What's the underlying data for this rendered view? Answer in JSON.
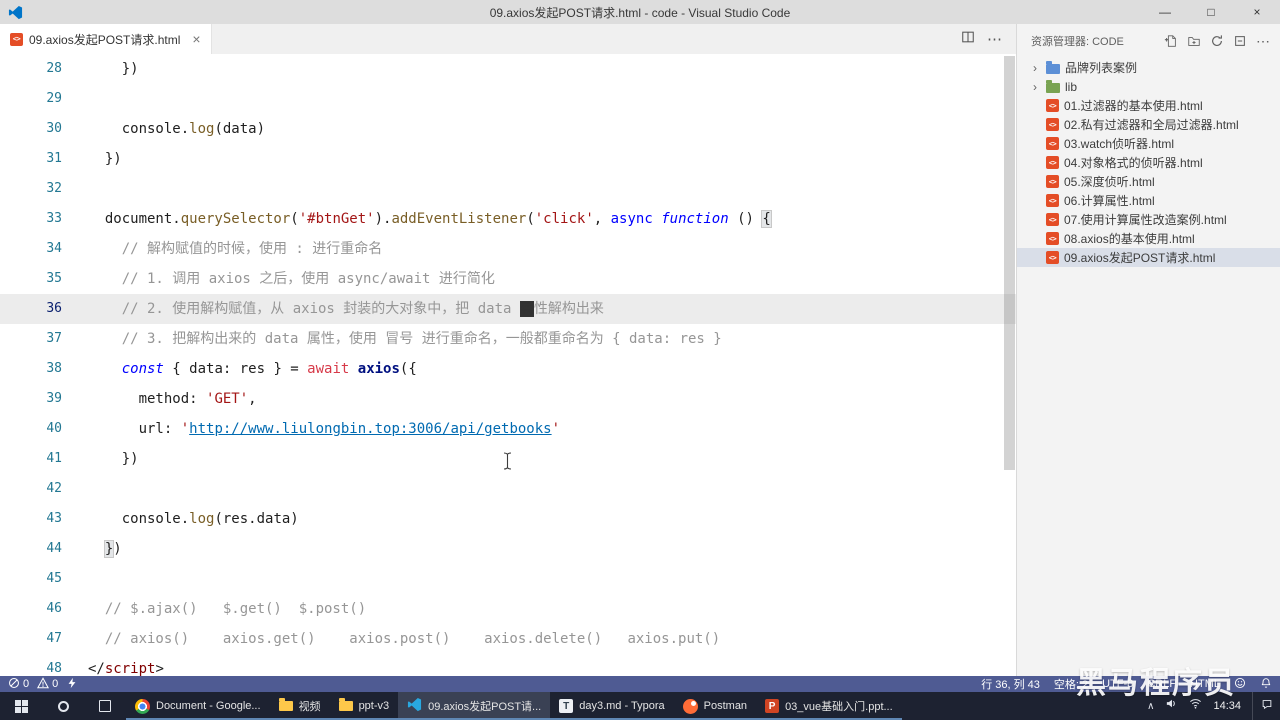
{
  "title_bar": {
    "title": "09.axios发起POST请求.html - code - Visual Studio Code",
    "minimize": "—",
    "maximize": "□",
    "close": "×"
  },
  "tab_bar": {
    "tabs": [
      {
        "label": "09.axios发起POST请求.html",
        "close": "×"
      }
    ],
    "more": "⋯"
  },
  "icons": {
    "chevron": "›",
    "chevron_up": "∧",
    "html_badge": "<>",
    "more": "⋯"
  },
  "colors": {
    "accent_blue": "#0075c9",
    "html_orange": "#e44d26",
    "status_bg": "#4f5b93"
  },
  "editor": {
    "active_line": 36,
    "lines": [
      {
        "n": 28,
        "s": [
          [
            "pl",
            "    })"
          ]
        ]
      },
      {
        "n": 29,
        "s": []
      },
      {
        "n": 30,
        "s": [
          [
            "pl",
            "    console."
          ],
          [
            "fn",
            "log"
          ],
          [
            "pl",
            "(data)"
          ]
        ]
      },
      {
        "n": 31,
        "s": [
          [
            "pl",
            "  })"
          ]
        ]
      },
      {
        "n": 32,
        "s": []
      },
      {
        "n": 33,
        "s": [
          [
            "pl",
            "  document."
          ],
          [
            "fn",
            "querySelector"
          ],
          [
            "pl",
            "("
          ],
          [
            "str",
            "'#btnGet'"
          ],
          [
            "pl",
            ")."
          ],
          [
            "fn",
            "addEventListener"
          ],
          [
            "pl",
            "("
          ],
          [
            "str",
            "'click'"
          ],
          [
            "pl",
            ", "
          ],
          [
            "kw",
            "async"
          ],
          [
            "pl",
            " "
          ],
          [
            "kwi",
            "function"
          ],
          [
            "pl",
            " () "
          ],
          [
            "bm",
            "{"
          ]
        ]
      },
      {
        "n": 34,
        "s": [
          [
            "cm",
            "    // 解构赋值的时候，使用 : 进行重命名"
          ]
        ]
      },
      {
        "n": 35,
        "s": [
          [
            "cm",
            "    // 1. 调用 axios 之后，使用 async/await 进行简化"
          ]
        ]
      },
      {
        "n": 36,
        "s": [
          [
            "cm",
            "    // 2. 使用解构赋值，从 axios 封装的大对象中，把 data "
          ],
          [
            "cur",
            "属"
          ],
          [
            "cm",
            "性解构出来"
          ]
        ]
      },
      {
        "n": 37,
        "s": [
          [
            "cm",
            "    // 3. 把解构出来的 data 属性，使用 冒号 进行重命名，一般都重命名为 { data: res }"
          ]
        ]
      },
      {
        "n": 38,
        "s": [
          [
            "pl",
            "    "
          ],
          [
            "kwi",
            "const"
          ],
          [
            "pl",
            " { data: res } = "
          ],
          [
            "aw",
            "await"
          ],
          [
            "pl",
            " "
          ],
          [
            "ax",
            "axios"
          ],
          [
            "pl",
            "({"
          ]
        ]
      },
      {
        "n": 39,
        "s": [
          [
            "pl",
            "      method: "
          ],
          [
            "str",
            "'GET'"
          ],
          [
            "pl",
            ","
          ]
        ]
      },
      {
        "n": 40,
        "s": [
          [
            "pl",
            "      url: "
          ],
          [
            "str",
            "'"
          ],
          [
            "lnk",
            "http://www.liulongbin.top:3006/api/getbooks"
          ],
          [
            "str",
            "'"
          ]
        ]
      },
      {
        "n": 41,
        "s": [
          [
            "pl",
            "    })"
          ]
        ]
      },
      {
        "n": 42,
        "s": []
      },
      {
        "n": 43,
        "s": [
          [
            "pl",
            "    console."
          ],
          [
            "fn",
            "log"
          ],
          [
            "pl",
            "(res.data)"
          ]
        ]
      },
      {
        "n": 44,
        "s": [
          [
            "pl",
            "  "
          ],
          [
            "bm",
            "}"
          ],
          [
            "pl",
            ")"
          ]
        ]
      },
      {
        "n": 45,
        "s": []
      },
      {
        "n": 46,
        "s": [
          [
            "cm",
            "  // $.ajax()   $.get()  $.post()"
          ]
        ]
      },
      {
        "n": 47,
        "s": [
          [
            "cm",
            "  // axios()    axios.get()    axios.post()    axios.delete()   axios.put()"
          ]
        ]
      },
      {
        "n": 48,
        "s": [
          [
            "pl",
            "</"
          ],
          [
            "tagn",
            "script"
          ],
          [
            "pl",
            ">"
          ]
        ]
      }
    ]
  },
  "sidebar": {
    "header": "资源管理器: CODE",
    "actions": [
      "new-file",
      "new-folder",
      "refresh",
      "collapse",
      "more"
    ],
    "items": [
      {
        "type": "folder",
        "label": "品牌列表案例",
        "color": "#5c8fd6"
      },
      {
        "type": "folder",
        "label": "lib",
        "color": "#79a352"
      },
      {
        "type": "file",
        "label": "01.过滤器的基本使用.html"
      },
      {
        "type": "file",
        "label": "02.私有过滤器和全局过滤器.html"
      },
      {
        "type": "file",
        "label": "03.watch侦听器.html"
      },
      {
        "type": "file",
        "label": "04.对象格式的侦听器.html"
      },
      {
        "type": "file",
        "label": "05.深度侦听.html"
      },
      {
        "type": "file",
        "label": "06.计算属性.html"
      },
      {
        "type": "file",
        "label": "07.使用计算属性改造案例.html"
      },
      {
        "type": "file",
        "label": "08.axios的基本使用.html"
      },
      {
        "type": "file",
        "label": "09.axios发起POST请求.html",
        "selected": true
      }
    ]
  },
  "status_bar": {
    "left": [
      {
        "icon": "circle-slash",
        "count": "0"
      },
      {
        "icon": "warning",
        "count": "0"
      },
      {
        "icon": "lightning",
        "count": ""
      }
    ],
    "items": [
      "行 36, 列 43",
      "空格: 2",
      "UTF-8",
      "CRLF",
      "HTML"
    ],
    "right_icons": [
      "smiley",
      "bell"
    ]
  },
  "watermark": "黑马程序员",
  "taskbar": {
    "apps": [
      {
        "kind": "chrome",
        "label": "Document - Google..."
      },
      {
        "kind": "folder",
        "label": "视频"
      },
      {
        "kind": "folder",
        "label": "ppt-v3"
      },
      {
        "kind": "vscode",
        "label": "09.axios发起POST请...",
        "active": true
      },
      {
        "kind": "typora",
        "label": "day3.md - Typora",
        "glyph": "T"
      },
      {
        "kind": "postman",
        "label": "Postman"
      },
      {
        "kind": "ppt",
        "label": "03_vue基础入门.ppt...",
        "glyph": "P"
      }
    ],
    "tray_time": "14:34"
  }
}
